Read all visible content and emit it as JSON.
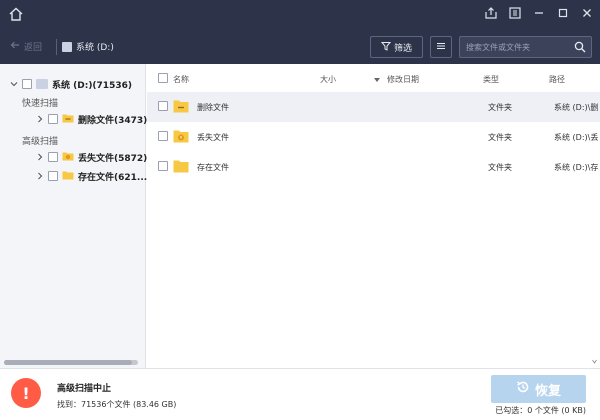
{
  "toolbar": {
    "back_label": "返回",
    "crumb_label": "系统 (D:)",
    "filter_label": "筛选",
    "search_placeholder": "搜索文件或文件夹"
  },
  "tree": {
    "root_label": "系统 (D:)(71536)",
    "quick_scan_label": "快速扫描",
    "deleted_label": "删除文件(3473)",
    "advanced_scan_label": "高级扫描",
    "lost_label": "丢失文件(5872)",
    "existing_label": "存在文件(621..."
  },
  "table": {
    "headers": {
      "name": "名称",
      "size": "大小",
      "modified": "修改日期",
      "type": "类型",
      "path": "路径"
    },
    "rows": [
      {
        "name": "删除文件",
        "size": "",
        "modified": "",
        "type": "文件夹",
        "path": "系统 (D:)\\删",
        "icon": "deleted-folder-icon"
      },
      {
        "name": "丢失文件",
        "size": "",
        "modified": "",
        "type": "文件夹",
        "path": "系统 (D:)\\丢",
        "icon": "lost-folder-icon"
      },
      {
        "name": "存在文件",
        "size": "",
        "modified": "",
        "type": "文件夹",
        "path": "系统 (D:)\\存",
        "icon": "folder-icon"
      }
    ]
  },
  "status": {
    "title": "高级扫描中止",
    "found": "找到：71536个文件 (83.46 GB)",
    "recover_label": "恢复",
    "selected_info": "已勾选：0 个文件 (0 KB)"
  },
  "colors": {
    "titlebar": "#2d3348",
    "accent_warning": "#ff5b45",
    "folder_yellow": "#f7c844",
    "recover_disabled": "#b6d4ee"
  }
}
